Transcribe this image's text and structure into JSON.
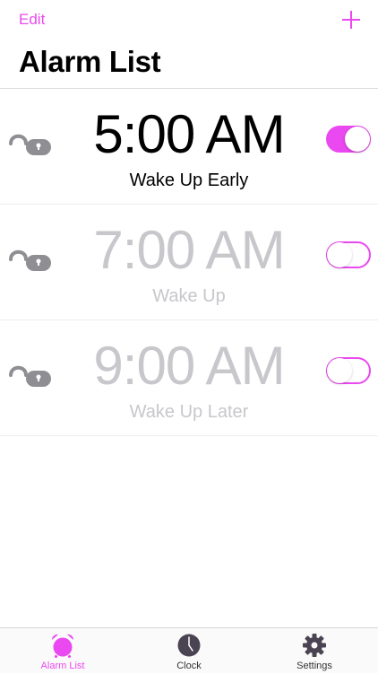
{
  "colors": {
    "accent": "#ea48f0",
    "enabled_text": "#000000",
    "disabled_text": "#c7c7cc",
    "icon_gray": "#8e8e93",
    "tab_inactive_icon": "#4a4452"
  },
  "nav": {
    "edit_label": "Edit",
    "add_icon": "plus-icon",
    "title": "Alarm List"
  },
  "alarms": [
    {
      "time": "5:00 AM",
      "label": "Wake Up Early",
      "enabled": true
    },
    {
      "time": "7:00 AM",
      "label": "Wake Up",
      "enabled": false
    },
    {
      "time": "9:00 AM",
      "label": "Wake Up Later",
      "enabled": false
    }
  ],
  "tabs": [
    {
      "label": "Alarm List",
      "icon": "alarm-clock-icon",
      "active": true
    },
    {
      "label": "Clock",
      "icon": "clock-icon",
      "active": false
    },
    {
      "label": "Settings",
      "icon": "gear-icon",
      "active": false
    }
  ]
}
